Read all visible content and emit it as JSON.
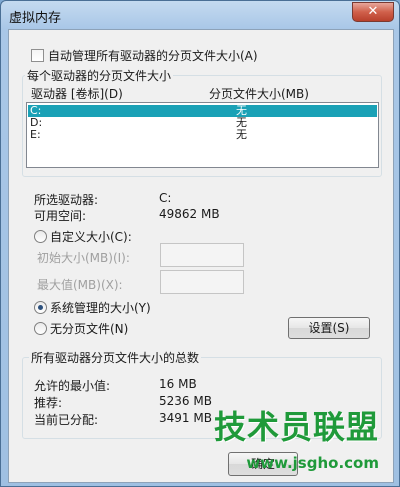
{
  "window": {
    "title": "虚拟内存",
    "close_glyph": "✕"
  },
  "auto_manage": {
    "label": "自动管理所有驱动器的分页文件大小(A)",
    "checked": false
  },
  "drive_group": {
    "title": "每个驱动器的分页文件大小",
    "col_drive": "驱动器 [卷标](D)",
    "col_size": "分页文件大小(MB)",
    "rows": [
      {
        "drive": "C:",
        "size": "无",
        "selected": true
      },
      {
        "drive": "D:",
        "size": "无",
        "selected": false
      },
      {
        "drive": "E:",
        "size": "无",
        "selected": false
      }
    ]
  },
  "selected_drive": {
    "label": "所选驱动器:",
    "value": "C:"
  },
  "free_space": {
    "label": "可用空间:",
    "value": "49862 MB"
  },
  "custom_size": {
    "label": "自定义大小(C):",
    "checked": false
  },
  "initial_size": {
    "label": "初始大小(MB)(I):",
    "value": ""
  },
  "max_size": {
    "label": "最大值(MB)(X):",
    "value": ""
  },
  "system_managed": {
    "label": "系统管理的大小(Y)",
    "checked": true
  },
  "no_paging": {
    "label": "无分页文件(N)",
    "checked": false
  },
  "set_button": {
    "label": "设置(S)"
  },
  "totals_group": {
    "title": "所有驱动器分页文件大小的总数",
    "min_label": "允许的最小值:",
    "min_value": "16 MB",
    "rec_label": "推荐:",
    "rec_value": "5236 MB",
    "cur_label": "当前已分配:",
    "cur_value": "3491 MB"
  },
  "ok_button": {
    "label": "确定"
  },
  "watermark": {
    "text": "技术员联盟",
    "url": "www.jsgho.com"
  }
}
